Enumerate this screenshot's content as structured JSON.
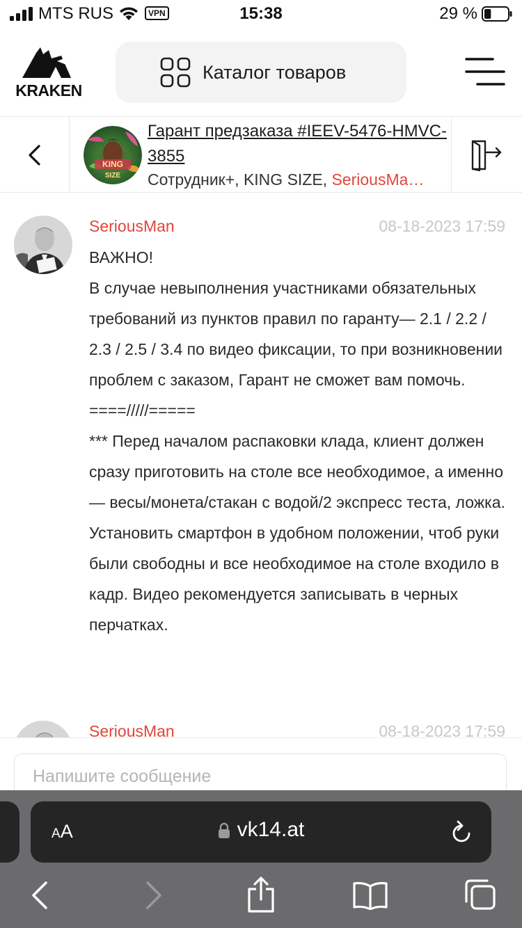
{
  "status_bar": {
    "carrier": "MTS RUS",
    "vpn": "VPN",
    "time": "15:38",
    "battery": "29 %",
    "battery_level": 0.29
  },
  "header": {
    "logo_text": "KRAKEN",
    "catalog_label": "Каталог товаров"
  },
  "chat": {
    "title": "Гарант предзаказа #IEEV-5476-HMVC-3855",
    "members_prefix": "Сотрудник+, KING SIZE, ",
    "members_highlight": "SeriousMa…",
    "avatar_text": "KING SIZE"
  },
  "messages": [
    {
      "author": "SeriousMan",
      "time": "08-18-2023 17:59",
      "body": "ВАЖНО!\nВ случае невыполнения участниками обязательных требований из пунктов правил по гаранту— 2.1 / 2.2 / 2.3 / 2.5 / 3.4 по видео фиксации, то при возникновении проблем с заказом, Гарант не сможет вам помочь.\n====/////=====\n*** Перед началом распаковки клада, клиент должен сразу приготовить на столе все необходимое, а именно — весы/монета/стакан с водой/2 экспресс теста, ложка. Установить смартфон в удобном положении, чтоб руки были свободны и все необходимое на столе входило в кадр. Видео рекомендуется записывать в черных перчатках."
    },
    {
      "author": "SeriousMan",
      "time": "08-18-2023 17:59",
      "body": ""
    }
  ],
  "composer": {
    "placeholder": "Напишите сообщение"
  },
  "browser": {
    "aa_small": "A",
    "aa_large": "A",
    "url": "vk14.at"
  },
  "colors": {
    "accent": "#e0463a",
    "timestamp": "#c7c7cc",
    "safari_bar": "#6b6b6d",
    "url_field": "#252526"
  }
}
